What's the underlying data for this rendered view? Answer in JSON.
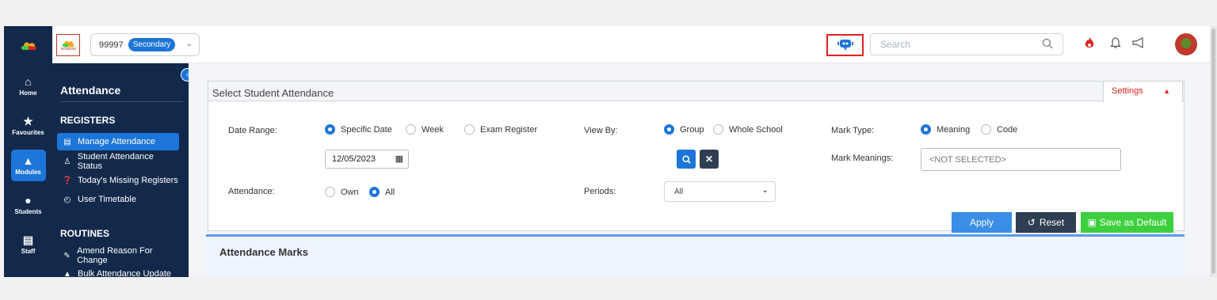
{
  "colors": {
    "nav_bg": "#13294b",
    "accent": "#1d75d8",
    "reset": "#2f3e52",
    "save": "#3ecf3e",
    "settings": "#e02020"
  },
  "topbar": {
    "school_logo_text": "ᴊᴇᴛᴍᴏᴏᴍ",
    "school_code": "99997",
    "school_level": "Secondary",
    "search_placeholder": "Search",
    "icons": [
      "bot-icon",
      "search-icon",
      "flame-icon",
      "bell-icon",
      "megaphone-icon",
      "avatar"
    ]
  },
  "leftnav": {
    "items": [
      {
        "label": "Home",
        "icon": "home-icon"
      },
      {
        "label": "Favourites",
        "icon": "star-icon"
      },
      {
        "label": "Modules",
        "icon": "modules-icon",
        "active": true
      },
      {
        "label": "Students",
        "icon": "user-icon"
      },
      {
        "label": "Staff",
        "icon": "staff-icon"
      }
    ]
  },
  "sidebar": {
    "title": "Attendance",
    "sections": [
      {
        "heading": "REGISTERS",
        "items": [
          {
            "label": "Manage Attendance",
            "icon": "register-icon",
            "active": true
          },
          {
            "label": "Student Attendance Status",
            "icon": "student-status-icon"
          },
          {
            "label": "Today's Missing Registers",
            "icon": "question-icon"
          },
          {
            "label": "User Timetable",
            "icon": "timetable-icon"
          }
        ]
      },
      {
        "heading": "ROUTINES",
        "items": [
          {
            "label": "Amend Reason For Change",
            "icon": "edit-icon"
          },
          {
            "label": "Bulk Attendance Update",
            "icon": "upload-icon"
          }
        ]
      }
    ]
  },
  "panel": {
    "title": "Select Student Attendance",
    "settings_label": "Settings",
    "date_range": {
      "label": "Date Range:",
      "options": [
        "Specific Date",
        "Week",
        "Exam Register"
      ],
      "selected": "Specific Date",
      "date_value": "12/05/2023"
    },
    "view_by": {
      "label": "View By:",
      "options": [
        "Group",
        "Whole School"
      ],
      "selected": "Group"
    },
    "mark_type": {
      "label": "Mark Type:",
      "options": [
        "Meaning",
        "Code"
      ],
      "selected": "Meaning"
    },
    "mark_meanings": {
      "label": "Mark Meanings:",
      "value": "<NOT SELECTED>"
    },
    "attendance": {
      "label": "Attendance:",
      "options": [
        "Own",
        "All"
      ],
      "selected": "All"
    },
    "periods": {
      "label": "Periods:",
      "value": "All"
    },
    "buttons": {
      "apply": "Apply",
      "reset": "Reset",
      "save_default": "Save as Default"
    }
  },
  "marks_panel": {
    "title": "Attendance Marks"
  }
}
